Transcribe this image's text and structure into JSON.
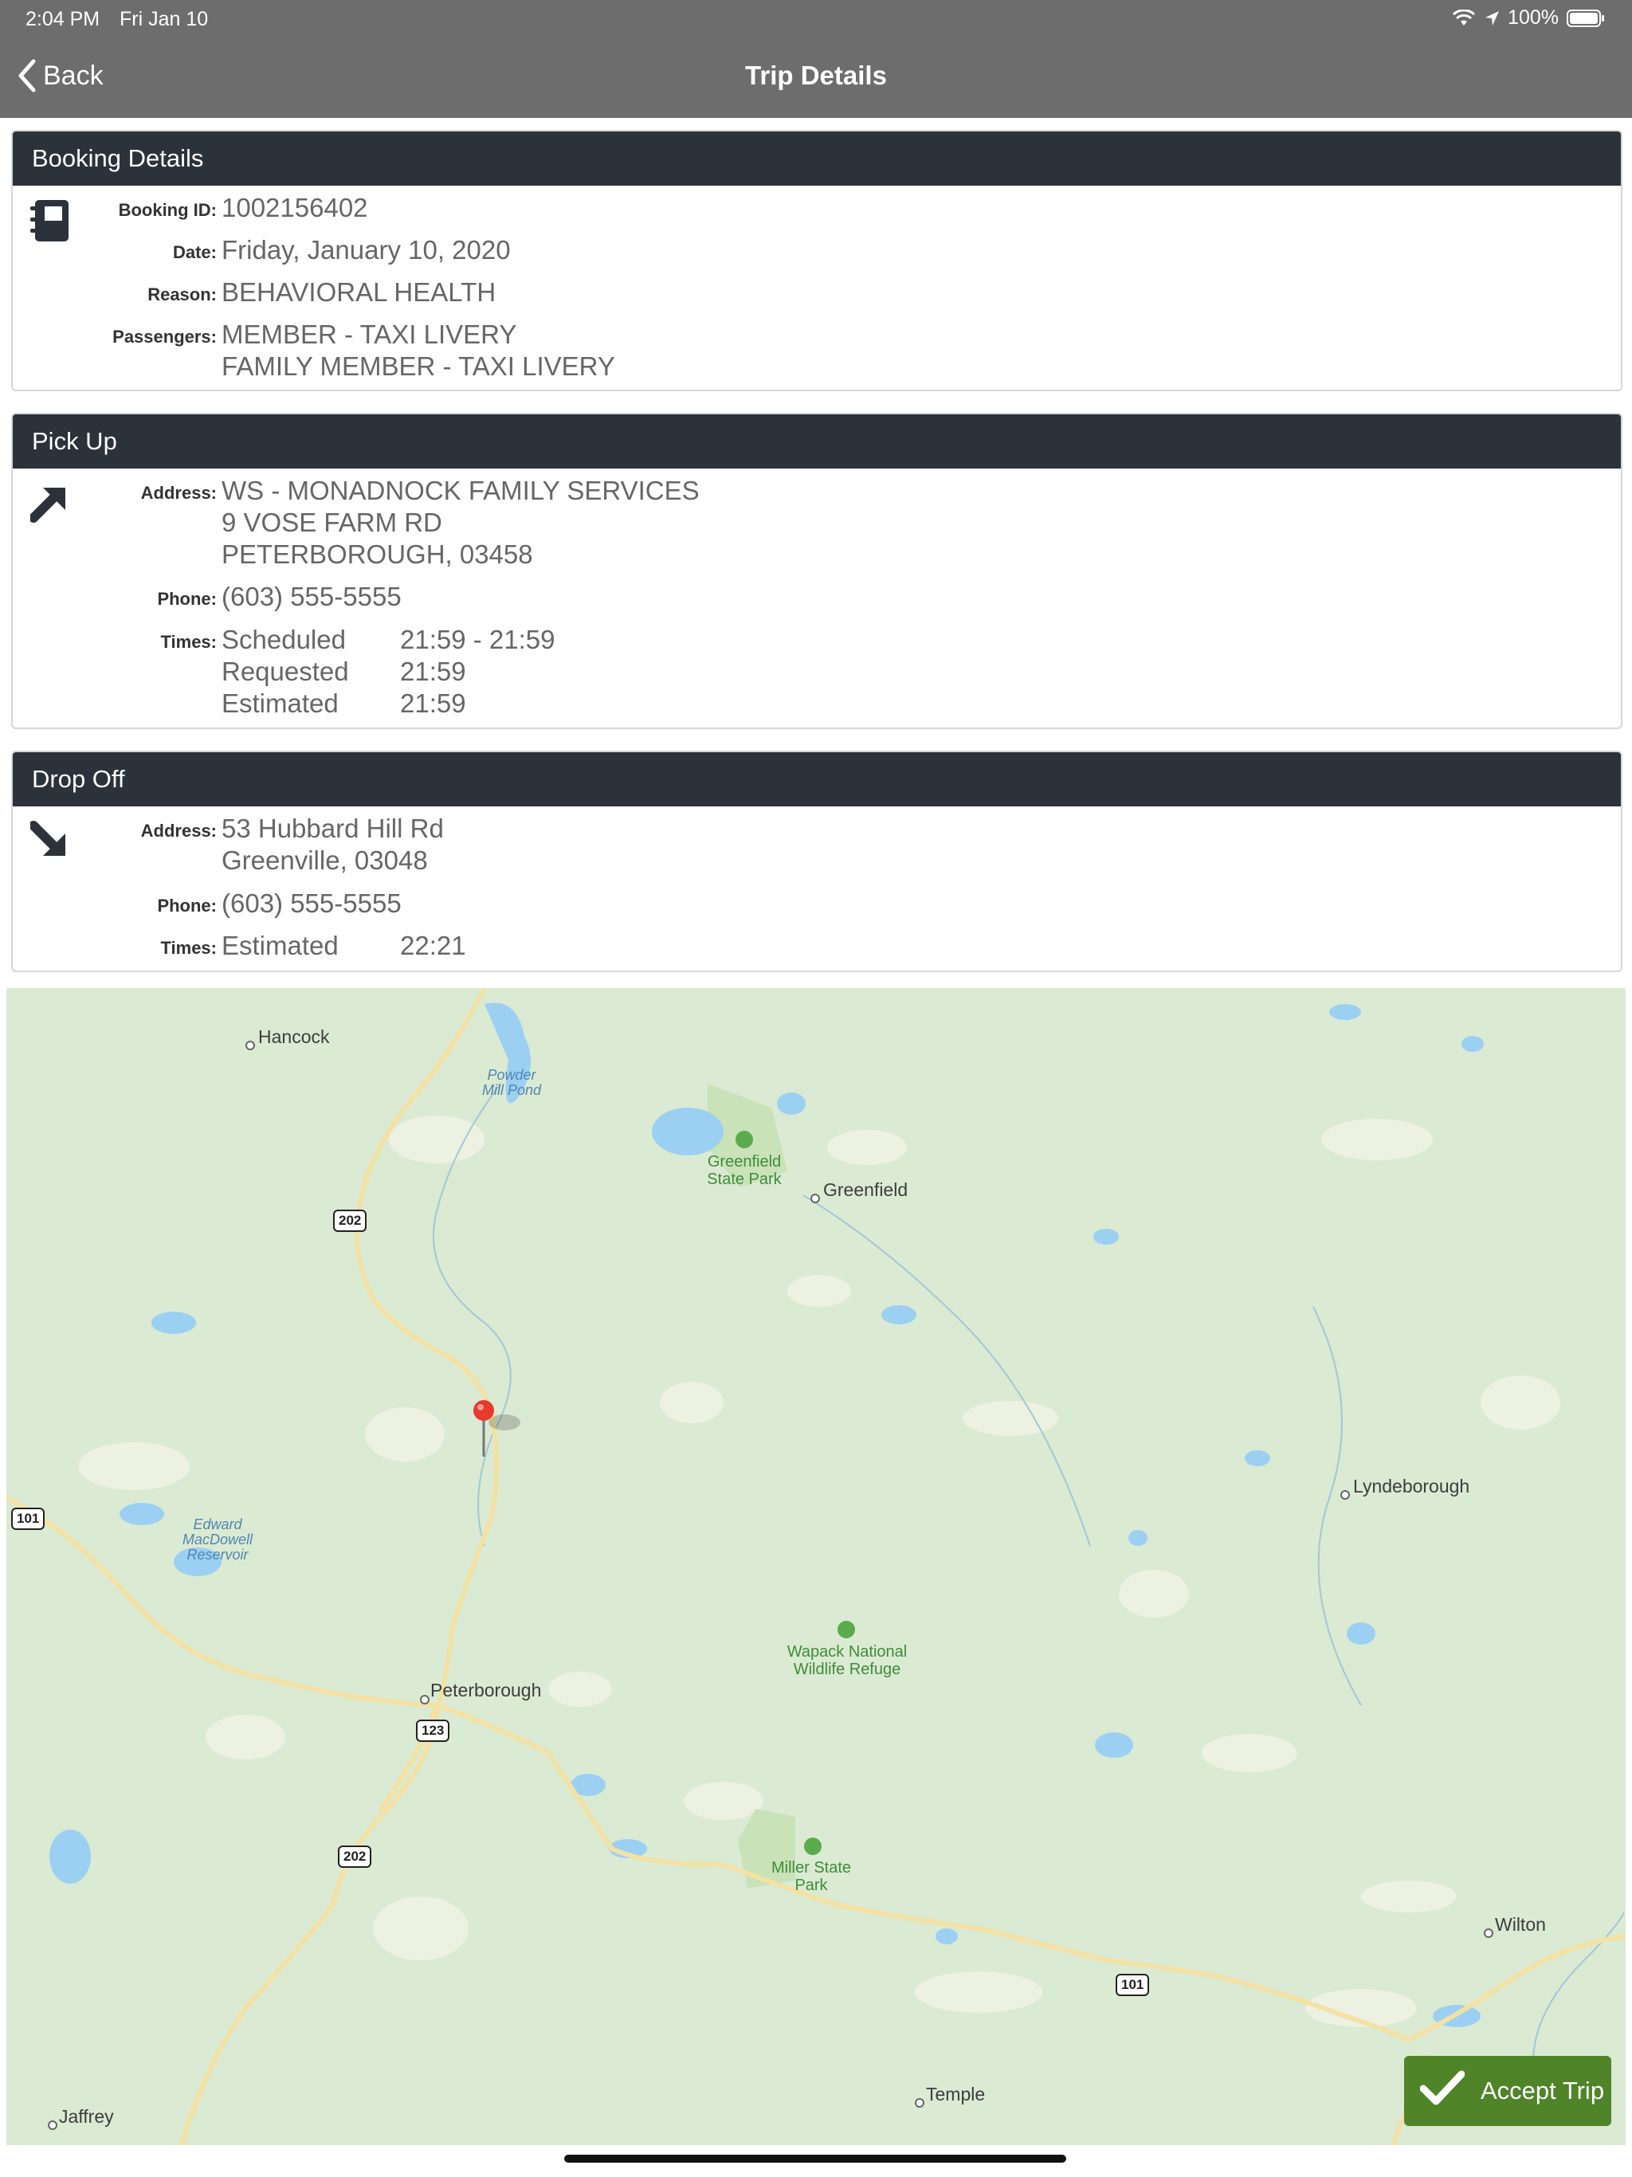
{
  "status_bar": {
    "time": "2:04 PM",
    "date": "Fri Jan 10",
    "battery": "100%"
  },
  "nav": {
    "back_label": "Back",
    "title": "Trip Details"
  },
  "booking": {
    "header": "Booking Details",
    "id_label": "Booking ID:",
    "id_value": "1002156402",
    "date_label": "Date:",
    "date_value": "Friday, January 10, 2020",
    "reason_label": "Reason:",
    "reason_value": "BEHAVIORAL HEALTH",
    "passengers_label": "Passengers:",
    "passengers": [
      "MEMBER - TAXI LIVERY",
      "FAMILY MEMBER - TAXI LIVERY"
    ]
  },
  "pickup": {
    "header": "Pick Up",
    "address_label": "Address:",
    "address": [
      "WS - MONADNOCK FAMILY SERVICES",
      "9 VOSE FARM RD",
      "PETERBOROUGH, 03458"
    ],
    "phone_label": "Phone:",
    "phone": "(603) 555-5555",
    "times_label": "Times:",
    "times": [
      {
        "type": "Scheduled",
        "value": "21:59 - 21:59"
      },
      {
        "type": "Requested",
        "value": "21:59"
      },
      {
        "type": "Estimated",
        "value": "21:59"
      }
    ]
  },
  "dropoff": {
    "header": "Drop Off",
    "address_label": "Address:",
    "address": [
      "53 Hubbard Hill Rd",
      "Greenville, 03048"
    ],
    "phone_label": "Phone:",
    "phone": "(603) 555-5555",
    "times_label": "Times:",
    "times": [
      {
        "type": "Estimated",
        "value": "22:21"
      }
    ]
  },
  "map": {
    "towns": [
      "Hancock",
      "Greenfield",
      "Lyndeborough",
      "Peterborough",
      "Wilton",
      "Temple",
      "Jaffrey"
    ],
    "parks": [
      "Greenfield State Park",
      "Wapack National Wildlife Refuge",
      "Miller State Park"
    ],
    "water": [
      "Powder Mill Pond",
      "Edward MacDowell Reservoir"
    ],
    "shields": [
      "202",
      "101",
      "123",
      "202",
      "101"
    ]
  },
  "accept_label": "Accept Trip",
  "colors": {
    "nav_bg": "#6d6d6d",
    "panel_header": "#2c323a",
    "accept": "#4f8428",
    "map_bg": "#dbead2",
    "pin": "#e63a2e"
  }
}
